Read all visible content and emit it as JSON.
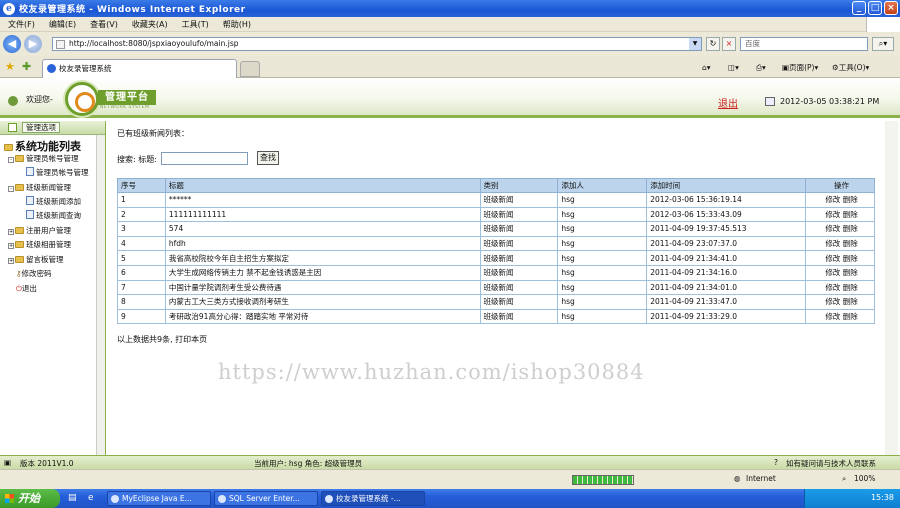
{
  "window": {
    "title": "校友录管理系统 - Windows Internet Explorer",
    "icon": "ie-icon"
  },
  "menubar": [
    "文件(F)",
    "编辑(E)",
    "查看(V)",
    "收藏夹(A)",
    "工具(T)",
    "帮助(H)"
  ],
  "address": {
    "url": "http://localhost:8080/jspxiaoyoulufo/main.jsp",
    "search_placeholder": "百度"
  },
  "tab": {
    "label": "校友录管理系统"
  },
  "commandbar": {
    "page": "页面(P)",
    "tools": "工具(O)"
  },
  "header": {
    "welcome": "欢迎您-",
    "logo_text": "管理平台",
    "logo_sub": "NETWORK SYSTEM",
    "logout": "退出",
    "datetime": "2012-03-05 03:38:21 PM"
  },
  "sidebar": {
    "head_label": "管理选项",
    "tree_title": "系统功能列表",
    "items": [
      {
        "label": "管理员帐号管理",
        "level": 0
      },
      {
        "label": "管理员帐号管理",
        "level": 1
      },
      {
        "label": "班级新闻管理",
        "level": 0
      },
      {
        "label": "班级新闻添加",
        "level": 1
      },
      {
        "label": "班级新闻查询",
        "level": 1
      },
      {
        "label": "注册用户管理",
        "level": 0
      },
      {
        "label": "班级相册管理",
        "level": 0
      },
      {
        "label": "留言板管理",
        "level": 0
      },
      {
        "label": "修改密码",
        "level": 0
      },
      {
        "label": "退出",
        "level": 0
      }
    ]
  },
  "main": {
    "list_title": "已有班级新闻列表：",
    "search_label": "搜索: 标题:",
    "search_value": "",
    "search_button": "查找",
    "columns": [
      "序号",
      "标题",
      "类别",
      "添加人",
      "添加时间",
      "操作"
    ],
    "rows": [
      {
        "no": "1",
        "title": "******",
        "type": "班级新闻",
        "user": "hsg",
        "time": "2012-03-06 15:36:19.14"
      },
      {
        "no": "2",
        "title": "111111111111",
        "type": "班级新闻",
        "user": "hsg",
        "time": "2012-03-06 15:33:43.09"
      },
      {
        "no": "3",
        "title": "574",
        "type": "班级新闻",
        "user": "hsg",
        "time": "2011-04-09 19:37:45.513"
      },
      {
        "no": "4",
        "title": "hfdh",
        "type": "班级新闻",
        "user": "hsg",
        "time": "2011-04-09 23:07:37.0"
      },
      {
        "no": "5",
        "title": "我省高校院校今年自主招生方案拟定",
        "type": "班级新闻",
        "user": "hsg",
        "time": "2011-04-09 21:34:41.0"
      },
      {
        "no": "6",
        "title": "大学生成网络传销主力 禁不起金钱诱惑是主因",
        "type": "班级新闻",
        "user": "hsg",
        "time": "2011-04-09 21:34:16.0"
      },
      {
        "no": "7",
        "title": "中国计量学院调剂考生受公费待遇",
        "type": "班级新闻",
        "user": "hsg",
        "time": "2011-04-09 21:34:01.0"
      },
      {
        "no": "8",
        "title": "内蒙古工大三类方式接收调剂考研生",
        "type": "班级新闻",
        "user": "hsg",
        "time": "2011-04-09 21:33:47.0"
      },
      {
        "no": "9",
        "title": "考研政治91高分心得：踏踏实地 平常对待",
        "type": "班级新闻",
        "user": "hsg",
        "time": "2011-04-09 21:33:29.0"
      }
    ],
    "op_edit": "修改",
    "op_delete": "删除",
    "footer": "以上数据共9条, 打印本页",
    "watermark": "https://www.huzhan.com/ishop30884"
  },
  "appstatus": {
    "version": "版本 2011V1.0",
    "user": "当前用户: hsg  角色: 超级管理员",
    "contact": "如有疑问请与技术人员联系"
  },
  "iestatus": {
    "zone": "Internet",
    "zoom": "100%"
  },
  "taskbar": {
    "start": "开始",
    "tasks": [
      "MyEclipse Java E...",
      "SQL Server Enter...",
      "校友录管理系统 -..."
    ],
    "clock": "15:38"
  }
}
